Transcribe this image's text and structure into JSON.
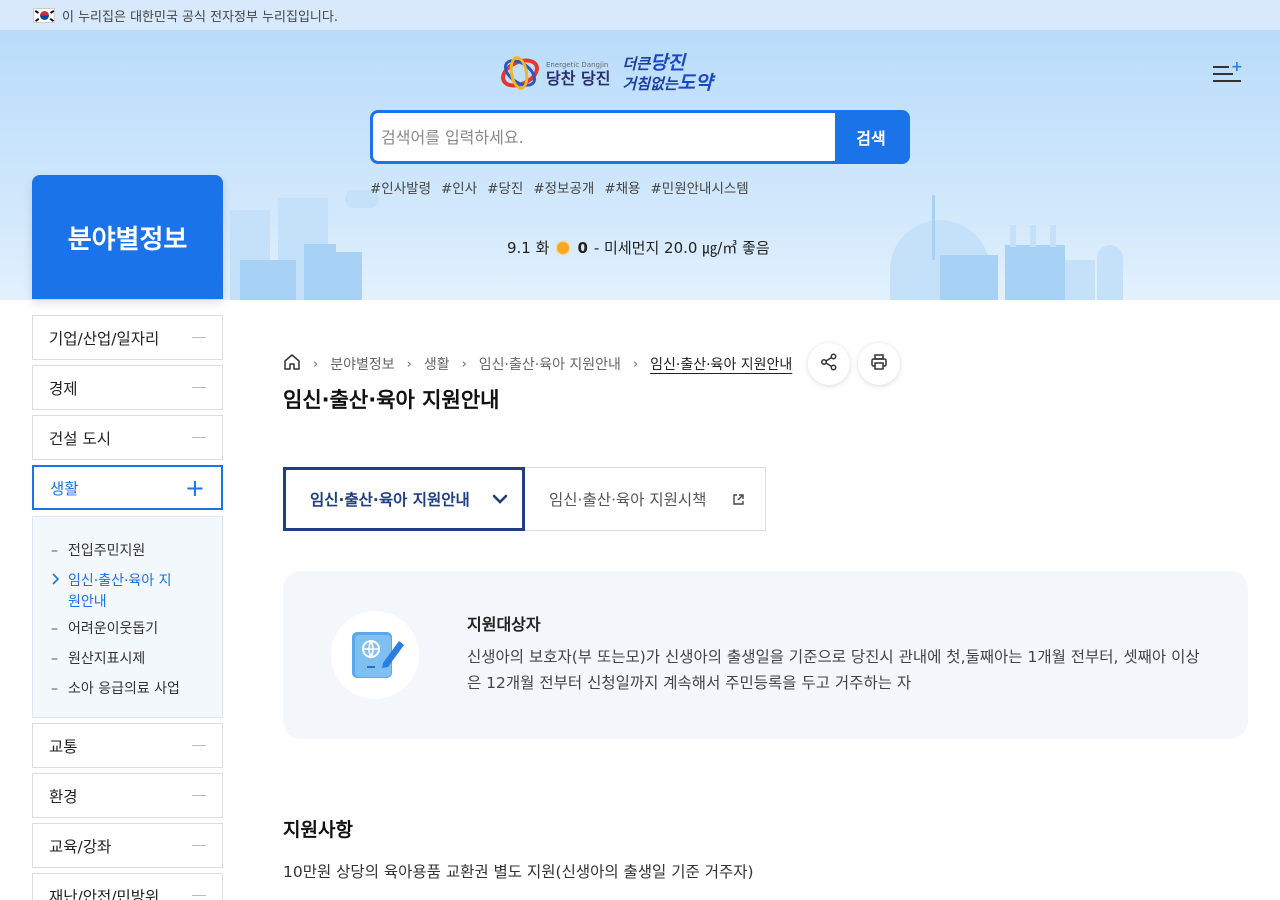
{
  "gov_bar": {
    "text": "이 누리집은 대한민국 공식 전자정부 누리집입니다."
  },
  "logo": {
    "emblem_sub": "Energetic Dangjin",
    "emblem_text": "당찬 당진",
    "slogan_line1_a": "더큰",
    "slogan_line1_b": "당진",
    "slogan_line2_a": "거침없는",
    "slogan_line2_b": "도약"
  },
  "search": {
    "placeholder": "검색어를 입력하세요.",
    "button": "검색"
  },
  "tags": [
    "#인사발령",
    "#인사",
    "#당진",
    "#정보공개",
    "#채용",
    "#민원안내시스템"
  ],
  "weather": {
    "date": "9.1 화",
    "temp": "0",
    "dust": "- 미세먼지 20.0 ㎍/㎥ 좋음"
  },
  "category": {
    "title": "분야별정보"
  },
  "sidebar": {
    "items": [
      {
        "label": "기업/산업/일자리"
      },
      {
        "label": "경제"
      },
      {
        "label": "건설 도시"
      },
      {
        "label": "생활"
      },
      {
        "label": "교통"
      },
      {
        "label": "환경"
      },
      {
        "label": "교육/강좌"
      },
      {
        "label": "재난/안전/민방위"
      }
    ],
    "submenu": [
      {
        "label": "전입주민지원"
      },
      {
        "label": "임신·출산·육아 지원안내"
      },
      {
        "label": "어려운이웃돕기"
      },
      {
        "label": "원산지표시제"
      },
      {
        "label": "소아 응급의료 사업"
      }
    ]
  },
  "breadcrumb": [
    "분야별정보",
    "생활",
    "임신·출산·육아 지원안내",
    "임신·출산·육아 지원안내"
  ],
  "page": {
    "title": "임신·출산·육아 지원안내"
  },
  "tabs": [
    {
      "label": "임신·출산·육아 지원안내"
    },
    {
      "label": "임신·출산·육아 지원시책"
    }
  ],
  "info": {
    "heading": "지원대상자",
    "text": "신생아의 보호자(부 또는모)가 신생아의 출생일을 기준으로 당진시 관내에 첫,둘째아는 1개월 전부터, 셋째아 이상은 12개월 전부터 신청일까지 계속해서 주민등록을 두고 거주하는 자"
  },
  "section": {
    "title": "지원사항",
    "text": "10만원 상당의 육아용품 교환권 별도 지원(신생아의 출생일 기준 거주자)"
  },
  "colors": {
    "accent": "#1a73e8",
    "tab_border": "#1f3f7f"
  }
}
